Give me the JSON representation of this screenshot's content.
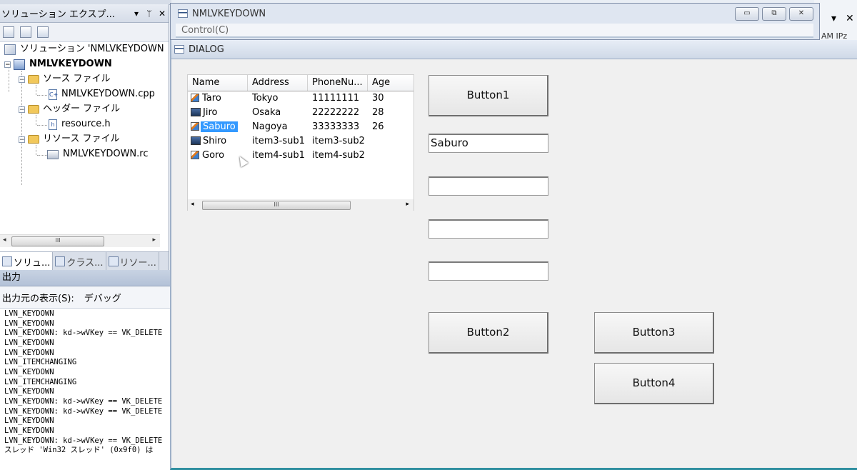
{
  "solution_explorer": {
    "title": "ソリューション エクスプ...",
    "title_buttons": [
      "▾",
      "ᛘ",
      "✕"
    ],
    "tree": [
      {
        "label": "ソリューション 'NMLVKEYDOWN"
      },
      {
        "label": "NMLVKEYDOWN"
      },
      {
        "label": "ソース ファイル"
      },
      {
        "label": "NMLVKEYDOWN.cpp"
      },
      {
        "label": "ヘッダー ファイル"
      },
      {
        "label": "resource.h"
      },
      {
        "label": "リソース ファイル"
      },
      {
        "label": "NMLVKEYDOWN.rc"
      }
    ],
    "scroll_grip": "III",
    "tabs": [
      "ソリュ...",
      "クラス...",
      "リソー..."
    ]
  },
  "output": {
    "title": "出力",
    "source_label": "出力元の表示(S):",
    "source_value": "デバッグ",
    "lines": [
      "LVN_KEYDOWN",
      "LVN_KEYDOWN",
      "LVN_KEYDOWN: kd->wVKey == VK_DELETE",
      "LVN_KEYDOWN",
      "LVN_KEYDOWN",
      "LVN_ITEMCHANGING",
      "LVN_KEYDOWN",
      "LVN_ITEMCHANGING",
      "LVN_KEYDOWN",
      "LVN_KEYDOWN: kd->wVKey == VK_DELETE",
      "LVN_KEYDOWN: kd->wVKey == VK_DELETE",
      "LVN_KEYDOWN",
      "LVN_KEYDOWN",
      "LVN_KEYDOWN: kd->wVKey == VK_DELETE",
      "スレッド 'Win32 スレッド' (0x9f0) は"
    ]
  },
  "ide_right": {
    "dropdown": "▾",
    "close": "✕",
    "sub": "AM IPz"
  },
  "main_window": {
    "title": "NMLVKEYDOWN",
    "menu": "Control(C)",
    "controls": {
      "minimize": "▭",
      "maximize": "⧉",
      "close": "✕"
    }
  },
  "dialog": {
    "title": "DIALOG",
    "listview": {
      "columns": [
        "Name",
        "Address",
        "PhoneNu...",
        "Age"
      ],
      "rows": [
        {
          "name": "Taro",
          "address": "Tokyo",
          "phone": "11111111",
          "age": "30",
          "icon": "edit-icon"
        },
        {
          "name": "Jiro",
          "address": "Osaka",
          "phone": "22222222",
          "age": "28",
          "icon": "computer-icon"
        },
        {
          "name": "Saburo",
          "address": "Nagoya",
          "phone": "33333333",
          "age": "26",
          "icon": "edit-icon",
          "selected": true
        },
        {
          "name": "Shiro",
          "address": "item3-sub1",
          "phone": "item3-sub2",
          "age": "",
          "icon": "computer-icon"
        },
        {
          "name": "Goro",
          "address": "item4-sub1",
          "phone": "item4-sub2",
          "age": "",
          "icon": "edit-icon"
        }
      ],
      "scroll_grip": "III"
    },
    "button1": "Button1",
    "edit1": "Saburo",
    "edit2": "",
    "edit3": "",
    "edit4": "",
    "button2": "Button2",
    "button3": "Button3",
    "button4": "Button4"
  }
}
